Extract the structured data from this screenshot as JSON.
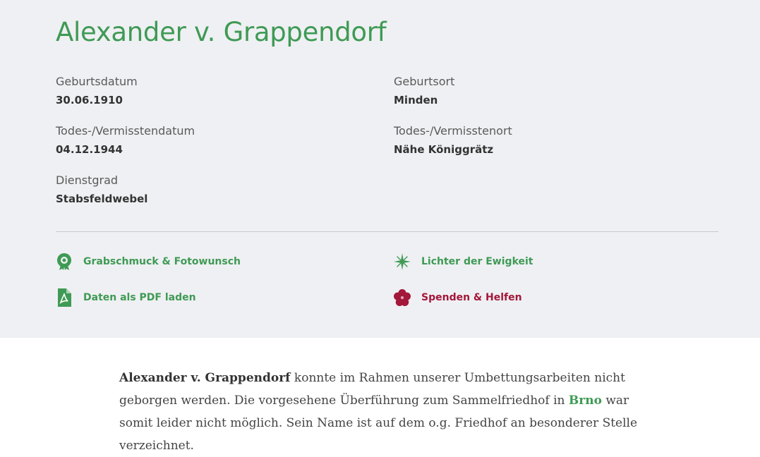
{
  "person": {
    "name": "Alexander v. Grappendorf"
  },
  "fields": {
    "birth_date": {
      "label": "Geburtsdatum",
      "value": "30.06.1910"
    },
    "birth_place": {
      "label": "Geburtsort",
      "value": "Minden"
    },
    "death_date": {
      "label": "Todes-/Vermisstendatum",
      "value": "04.12.1944"
    },
    "death_place": {
      "label": "Todes-/Vermisstenort",
      "value": "Nähe Königgrätz"
    },
    "rank": {
      "label": "Dienstgrad",
      "value": "Stabsfeldwebel"
    }
  },
  "actions": {
    "grave_decoration": {
      "label": "Grabschmuck & Fotowunsch",
      "icon": "wreath-icon"
    },
    "eternal_lights": {
      "label": "Lichter der Ewigkeit",
      "icon": "star-light-icon"
    },
    "pdf_download": {
      "label": "Daten als PDF laden",
      "icon": "pdf-file-icon"
    },
    "donate": {
      "label": "Spenden & Helfen",
      "icon": "flower-icon"
    }
  },
  "description": {
    "name": "Alexander v. Grappendorf",
    "part1": " konnte im Rahmen unserer Umbettungsarbeiten nicht geborgen werden. Die vorgesehene Überführung zum Sammelfriedhof in ",
    "place": "Brno",
    "part2": " war somit leider nicht möglich. Sein Name ist auf dem o.g. Friedhof an besonderer Stelle verzeichnet."
  },
  "colors": {
    "accent_green": "#3f9a55",
    "accent_red": "#a3173a",
    "panel_bg": "#eff0f3"
  }
}
